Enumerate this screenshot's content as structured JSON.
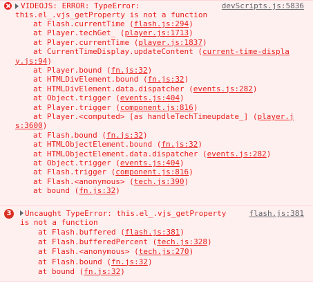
{
  "colors": {
    "error_text": "#e8211e",
    "error_background": "#fff0f0",
    "error_border": "#ffd6d6",
    "source_link": "#5f6368",
    "badge": "#d93025"
  },
  "messages": [
    {
      "icon": "error-x-icon",
      "header_text": "VIDEOJS: ERROR: TypeError:",
      "message_text": "this.el_.vjs_getProperty is not a function",
      "source": "devScripts.js:5836",
      "stack": [
        {
          "prefix": "at Flash.currentTime (",
          "link": "flash.js:294",
          "suffix": ")"
        },
        {
          "prefix": "at Player.techGet_ (",
          "link": "player.js:1713",
          "suffix": ")"
        },
        {
          "prefix": "at Player.currentTime (",
          "link": "player.js:1837",
          "suffix": ")"
        },
        {
          "prefix": "at CurrentTimeDisplay.updateContent (",
          "link": "current-time-displa",
          "suffix": ""
        },
        {
          "prefix": "",
          "link": "y.js:94",
          "suffix": ")"
        },
        {
          "prefix": "at Player.bound (",
          "link": "fn.js:32",
          "suffix": ")"
        },
        {
          "prefix": "at HTMLDivElement.bound (",
          "link": "fn.js:32",
          "suffix": ")"
        },
        {
          "prefix": "at HTMLDivElement.data.dispatcher (",
          "link": "events.js:282",
          "suffix": ")"
        },
        {
          "prefix": "at Object.trigger (",
          "link": "events.js:404",
          "suffix": ")"
        },
        {
          "prefix": "at Player.trigger (",
          "link": "component.js:816",
          "suffix": ")"
        },
        {
          "prefix": "at Player.<computed> [as handleTechTimeupdate_] (",
          "link": "player.j",
          "suffix": ""
        },
        {
          "prefix": "",
          "link": "s:3600",
          "suffix": ")"
        },
        {
          "prefix": "at Flash.bound (",
          "link": "fn.js:32",
          "suffix": ")"
        },
        {
          "prefix": "at HTMLObjectElement.bound (",
          "link": "fn.js:32",
          "suffix": ")"
        },
        {
          "prefix": "at HTMLObjectElement.data.dispatcher (",
          "link": "events.js:282",
          "suffix": ")"
        },
        {
          "prefix": "at Object.trigger (",
          "link": "events.js:404",
          "suffix": ")"
        },
        {
          "prefix": "at Flash.trigger (",
          "link": "component.js:816",
          "suffix": ")"
        },
        {
          "prefix": "at Flash.<anonymous> (",
          "link": "tech.js:390",
          "suffix": ")"
        },
        {
          "prefix": "at bound (",
          "link": "fn.js:32",
          "suffix": ")"
        }
      ]
    },
    {
      "icon": "error-count-badge",
      "count": "3",
      "header_text": "Uncaught TypeError: this.el_.vjs_getProperty",
      "message_text": "is not a function",
      "source": "flash.js:381",
      "stack": [
        {
          "prefix": "at Flash.buffered (",
          "link": "flash.js:381",
          "suffix": ")"
        },
        {
          "prefix": "at Flash.bufferedPercent (",
          "link": "tech.js:328",
          "suffix": ")"
        },
        {
          "prefix": "at Flash.<anonymous> (",
          "link": "tech.js:270",
          "suffix": ")"
        },
        {
          "prefix": "at Flash.bound (",
          "link": "fn.js:32",
          "suffix": ")"
        },
        {
          "prefix": "at bound (",
          "link": "fn.js:32",
          "suffix": ")"
        }
      ]
    }
  ]
}
